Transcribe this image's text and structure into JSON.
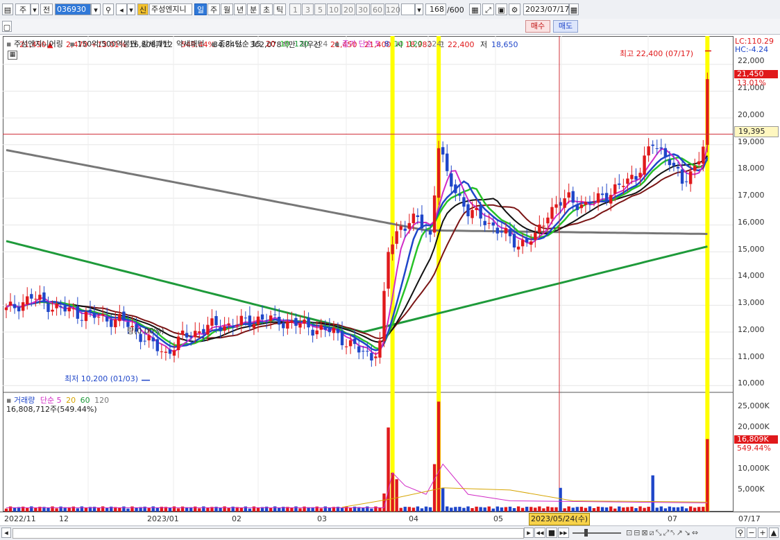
{
  "toolbar": {
    "period_unit": "주",
    "prev_label": "전",
    "stock_code": "036930",
    "new_badge": "신",
    "stock_name": "주성엔지니",
    "periods": [
      "일",
      "주",
      "월",
      "년",
      "분",
      "초",
      "틱"
    ],
    "selected_period": "일",
    "nums": [
      "1",
      "3",
      "5",
      "10",
      "20",
      "30",
      "60",
      "120"
    ],
    "count": "168",
    "count_total": "/600",
    "date": "2023/07/17"
  },
  "quote": {
    "price": "21,450",
    "change_arrow": "▲",
    "change": "2,470",
    "change_pct": "+13.01%",
    "volume": "16,808,712",
    "vol_ratio": "549.44%",
    "turnover": "34.84%",
    "amount": "362,078백만",
    "best_bid_label": "최우선",
    "best_ask": "21,450",
    "best_bid": "21,400",
    "open_label": "시",
    "open": "18,980",
    "high_label": "고",
    "high": "22,400",
    "low_label": "저",
    "low": "18,650",
    "buy_label": "매수",
    "sell_label": "매도"
  },
  "legend": {
    "name": "주성엔지니어링",
    "pattern1": "150억/500억봉찐",
    "pattern2": "강세패턴",
    "pattern3": "약세패턴",
    "ma1_title": "종가 단순 15",
    "ma1_periods": [
      "20",
      "10",
      "120",
      "224"
    ],
    "ma2_title": "종가 단순 5",
    "ma2_periods": [
      "8",
      "10",
      "120",
      "224"
    ],
    "vol_title": "거래량",
    "vol_ma_title": "단순 5",
    "vol_ma_periods": [
      "20",
      "60",
      "120"
    ],
    "vol_value": "16,808,712주(549.44%)"
  },
  "annotations": {
    "high_note": "최고 22,400 (07/17)",
    "low_note": "최저 10,200 (01/03)",
    "ghost_note": "량(0.00%)",
    "lc": "LC:110.29",
    "hc": "HC:-4.24",
    "price_tag": "21,450",
    "pct_tag": "13.01%",
    "crosshair_tag": "19,395",
    "vol_tag": "16,809K",
    "vol_pct_tag": "549.44%",
    "cursor_date": "2023/05/24(수)"
  },
  "price_axis": [
    "22,000",
    "21,000",
    "20,000",
    "19,000",
    "18,000",
    "17,000",
    "16,000",
    "15,000",
    "14,000",
    "13,000",
    "12,000",
    "11,000",
    "10,000"
  ],
  "volume_axis": [
    "25,000K",
    "20,000K",
    "15,000K",
    "10,000K",
    "5,000K"
  ],
  "x_axis": [
    "2022/11",
    "12",
    "2023/01",
    "02",
    "03",
    "04",
    "05",
    "06",
    "07",
    "07/17"
  ],
  "colors": {
    "up": "#e0191b",
    "down": "#1f46c9",
    "highlight": "#ffff00",
    "ma5": "#d12bc6",
    "ma8": "#1f46c9",
    "ma10": "#27c227",
    "ma15": "#111111",
    "ma20": "#7a1414",
    "ma120": "#1e9a3a",
    "ma224": "#777777"
  }
}
